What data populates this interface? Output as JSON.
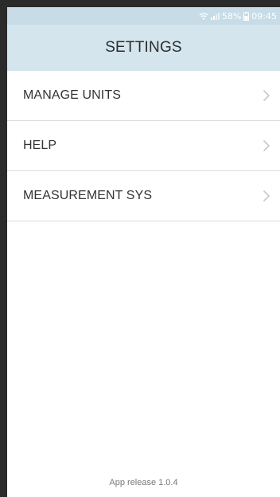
{
  "status_bar": {
    "wifi_icon": "wifi-icon",
    "signal_icon": "signal-icon",
    "battery_percent": "58%",
    "battery_icon": "battery-icon",
    "time": "09:45"
  },
  "header": {
    "title": "SETTINGS"
  },
  "menu": {
    "items": [
      {
        "label": "MANAGE UNITS",
        "icon": "chevron-right-icon"
      },
      {
        "label": "HELP",
        "icon": "chevron-right-icon"
      },
      {
        "label": "MEASUREMENT SYS",
        "icon": "chevron-right-icon"
      }
    ]
  },
  "footer": {
    "release": "App release 1.0.4"
  },
  "colors": {
    "header_bg": "#d4e5ee",
    "status_bg": "#c7dce6",
    "divider": "#d9d9d9",
    "chevron": "#c8c8c8"
  }
}
